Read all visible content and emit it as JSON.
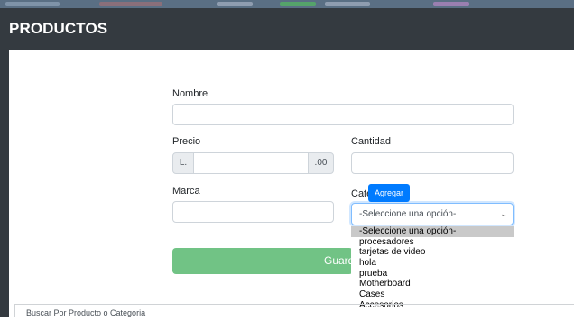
{
  "page": {
    "title": "PRODUCTOS"
  },
  "form": {
    "nombre_label": "Nombre",
    "precio_label": "Precio",
    "precio_prefix": "L.",
    "precio_suffix": ".00",
    "cantidad_label": "Cantidad",
    "marca_label": "Marca",
    "categorias_label": "Categorías",
    "agregar_label": "Agregar",
    "categoria_selected": "-Seleccione una opción-",
    "save_label": "Guard"
  },
  "dropdown": {
    "options": [
      "-Seleccione una opción-",
      "procesadores",
      "tarjetas de video",
      "hola",
      "prueba",
      "Motherboard",
      "Cases",
      "Accesorios"
    ]
  },
  "search": {
    "placeholder": "Buscar Por Producto o Categoria"
  },
  "colors": {
    "header": "#343a40",
    "primary": "#007bff",
    "success_disabled": "#71c385"
  }
}
